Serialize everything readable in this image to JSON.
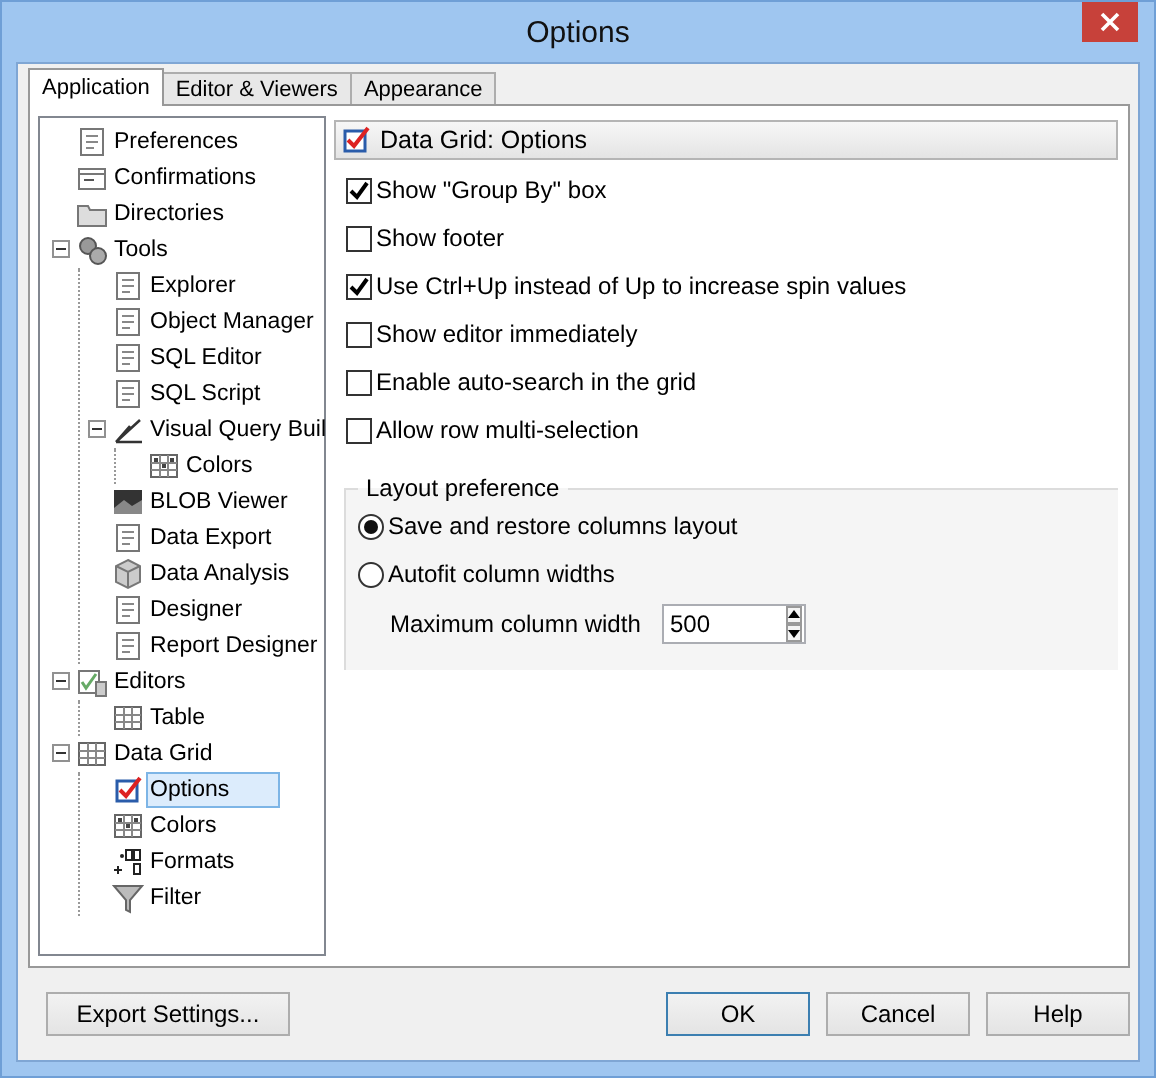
{
  "window": {
    "title": "Options"
  },
  "tabs": [
    {
      "label": "Application",
      "selected": true
    },
    {
      "label": "Editor & Viewers",
      "selected": false
    },
    {
      "label": "Appearance",
      "selected": false
    }
  ],
  "tree": [
    {
      "label": "Preferences",
      "selected": false
    },
    {
      "label": "Confirmations",
      "selected": false
    },
    {
      "label": "Directories",
      "selected": false
    },
    {
      "label": "Tools",
      "selected": false,
      "expanded": true,
      "children": [
        {
          "label": "Explorer",
          "selected": false
        },
        {
          "label": "Object Manager",
          "selected": false
        },
        {
          "label": "SQL Editor",
          "selected": false
        },
        {
          "label": "SQL Script",
          "selected": false
        },
        {
          "label": "Visual Query Buil",
          "selected": false,
          "expanded": true,
          "children": [
            {
              "label": "Colors",
              "selected": false
            }
          ]
        },
        {
          "label": "BLOB Viewer",
          "selected": false
        },
        {
          "label": "Data Export",
          "selected": false
        },
        {
          "label": "Data Analysis",
          "selected": false
        },
        {
          "label": "Designer",
          "selected": false
        },
        {
          "label": "Report Designer",
          "selected": false
        }
      ]
    },
    {
      "label": "Editors",
      "selected": false,
      "expanded": true,
      "children": [
        {
          "label": "Table",
          "selected": false
        }
      ]
    },
    {
      "label": "Data Grid",
      "selected": false,
      "expanded": true,
      "children": [
        {
          "label": "Options",
          "selected": true
        },
        {
          "label": "Colors",
          "selected": false
        },
        {
          "label": "Formats",
          "selected": false
        },
        {
          "label": "Filter",
          "selected": false
        }
      ]
    }
  ],
  "panel": {
    "title": "Data Grid: Options",
    "checkboxes": [
      {
        "label": "Show \"Group By\" box",
        "checked": true
      },
      {
        "label": "Show footer",
        "checked": false
      },
      {
        "label": "Use Ctrl+Up instead of Up to increase spin values",
        "checked": true
      },
      {
        "label": "Show editor immediately",
        "checked": false
      },
      {
        "label": "Enable auto-search in the grid",
        "checked": false
      },
      {
        "label": "Allow row multi-selection",
        "checked": false
      }
    ],
    "group": {
      "title": "Layout preference",
      "radios": [
        {
          "label": "Save and restore columns layout",
          "selected": true
        },
        {
          "label": "Autofit column widths",
          "selected": false
        }
      ],
      "spin": {
        "label": "Maximum column width",
        "value": "500"
      }
    }
  },
  "buttons": {
    "left": [
      "Export Settings..."
    ],
    "right": [
      "OK",
      "Cancel",
      "Help"
    ]
  }
}
